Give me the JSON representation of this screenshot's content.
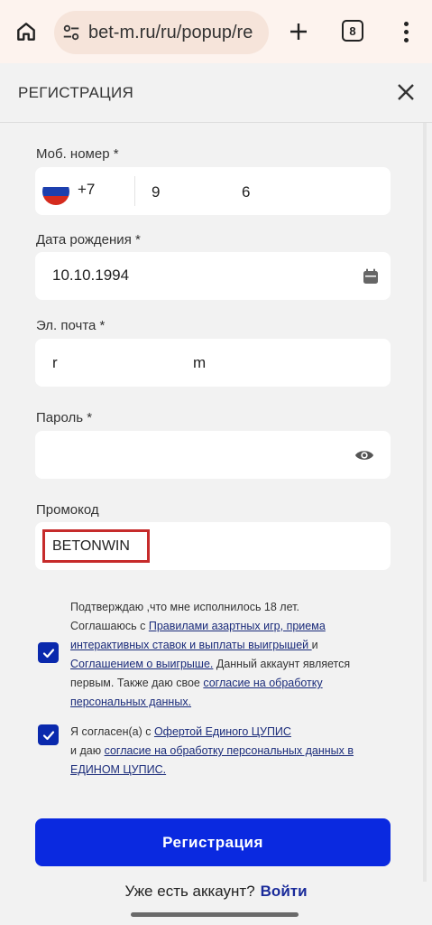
{
  "browser": {
    "url": "bet-m.ru/ru/popup/re",
    "tab_count": "8"
  },
  "modal": {
    "title": "РЕГИСТРАЦИЯ"
  },
  "form": {
    "phone": {
      "label": "Моб. номер *",
      "country_code": "+7",
      "digit_a": "9",
      "digit_b": "6"
    },
    "birthdate": {
      "label": "Дата рождения *",
      "value": "10.10.1994"
    },
    "email": {
      "label": "Эл. почта *",
      "fragment_a": "r",
      "fragment_b": "m"
    },
    "password": {
      "label": "Пароль *"
    },
    "promo": {
      "label": "Промокод",
      "value": "BETONWIN"
    }
  },
  "consent1": {
    "line1": "Подтверждаю ,что мне исполнилось 18 лет.",
    "agree_prefix": "Соглашаюсь с ",
    "rules_link": "Правилами азартных игр, приема интерактивных ставок и выплаты выигрышей ",
    "and": "и ",
    "winnings_link": "Соглашением о выигрыше.",
    "middle": " Данный аккаунт является первым. Также даю свое ",
    "personal_link": "согласие на обработку персональных данных."
  },
  "consent2": {
    "prefix": "Я согласен(а) с ",
    "offer_link": "Офертой Единого ЦУПИС",
    "middle": " и даю ",
    "personal_link": "согласие на обработку персональных данных в ЕДИНОМ ЦУПИС."
  },
  "actions": {
    "register_label": "Регистрация",
    "have_account": "Уже есть аккаунт?",
    "login_label": "Войти"
  },
  "colors": {
    "accent": "#0a29e0",
    "checkbox": "#0a29ad",
    "highlight": "#c62b2b"
  }
}
